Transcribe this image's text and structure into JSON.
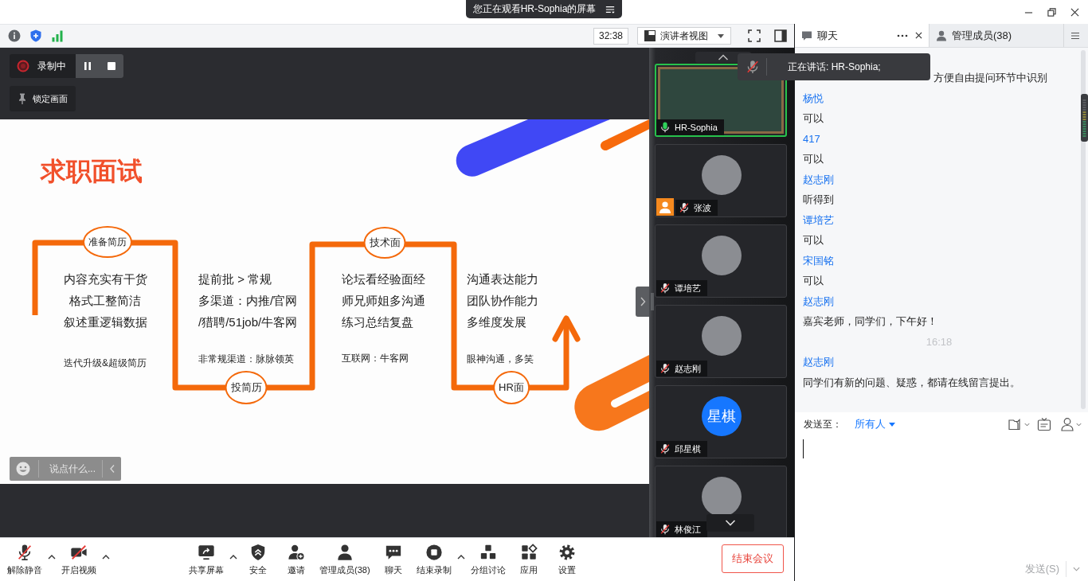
{
  "title_bar": {
    "banner": "您正在观看HR-Sophia的屏幕"
  },
  "top_toolbar": {
    "timer": "32:38",
    "view_button": "演讲者视图"
  },
  "recording": {
    "label": "录制中"
  },
  "lock_button": {
    "label": "锁定画面"
  },
  "slide": {
    "title": "求职面试",
    "stages": [
      {
        "label": "准备简历",
        "lines": [
          "内容充实有干货",
          "格式工整简洁",
          "叙述重逻辑数据"
        ],
        "note": "迭代升级&超级简历"
      },
      {
        "label": "投简历",
        "lines": [
          "提前批 > 常规",
          "多渠道：内推/官网",
          "/猎聘/51job/牛客网"
        ],
        "note": "非常规渠道：脉脉领英"
      },
      {
        "label": "技术面",
        "lines": [
          "论坛看经验面经",
          "师兄师姐多沟通",
          "练习总结复盘"
        ],
        "note": "互联网：牛客网"
      },
      {
        "label": "HR面",
        "lines": [
          "沟通表达能力",
          "团队协作能力",
          "多维度发展"
        ],
        "note": "眼神沟通，多笑"
      }
    ]
  },
  "comment_box": {
    "placeholder": "说点什么..."
  },
  "speaking_banner": {
    "text": "正在讲话: HR-Sophia;"
  },
  "participants": [
    {
      "name": "HR-Sophia",
      "kind": "video",
      "active_speaker": true,
      "muted": false,
      "co_host": false
    },
    {
      "name": "张波",
      "kind": "photo",
      "active_speaker": false,
      "muted": true,
      "co_host": true
    },
    {
      "name": "谭培艺",
      "kind": "photo",
      "active_speaker": false,
      "muted": true,
      "co_host": false
    },
    {
      "name": "赵志刚",
      "kind": "photo",
      "active_speaker": false,
      "muted": true,
      "co_host": false
    },
    {
      "name": "邱星棋",
      "kind": "initials",
      "initials": "星棋",
      "active_speaker": false,
      "muted": true,
      "co_host": false
    },
    {
      "name": "林俊江",
      "kind": "photo",
      "active_speaker": false,
      "muted": true,
      "co_host": false
    }
  ],
  "chat": {
    "tabs": [
      {
        "label": "聊天",
        "selected": true
      },
      {
        "label": "管理成员(38)",
        "selected": false
      }
    ],
    "messages": [
      {
        "kind": "text",
        "text": "方便自由提问环节中识别"
      },
      {
        "kind": "sender",
        "text": "杨悦"
      },
      {
        "kind": "text",
        "text": "可以"
      },
      {
        "kind": "sender",
        "text": "417"
      },
      {
        "kind": "text",
        "text": "可以"
      },
      {
        "kind": "sender",
        "text": "赵志刚"
      },
      {
        "kind": "text",
        "text": "听得到"
      },
      {
        "kind": "sender",
        "text": "谭培艺"
      },
      {
        "kind": "text",
        "text": "可以"
      },
      {
        "kind": "sender",
        "text": "宋国铭"
      },
      {
        "kind": "text",
        "text": "可以"
      },
      {
        "kind": "sender",
        "text": "赵志刚"
      },
      {
        "kind": "text",
        "text": "嘉宾老师，同学们，下午好！"
      },
      {
        "kind": "time",
        "text": "16:18"
      },
      {
        "kind": "sender",
        "text": "赵志刚"
      },
      {
        "kind": "text",
        "text": "同学们有新的问题、疑惑，都请在线留言提出。"
      }
    ],
    "send_to_label": "发送至：",
    "recipient": "所有人",
    "send_button": {
      "label": "发送(S)",
      "disabled": true
    }
  },
  "bottom_toolbar": {
    "left": [
      {
        "kind": "mic-off",
        "label": "解除静音",
        "menu": true
      },
      {
        "kind": "video-off",
        "label": "开启视频",
        "menu": true
      }
    ],
    "center": [
      {
        "kind": "share",
        "label": "共享屏幕",
        "menu": true
      },
      {
        "kind": "security",
        "label": "安全",
        "menu": false
      },
      {
        "kind": "invite",
        "label": "邀请",
        "menu": false
      },
      {
        "kind": "participants",
        "label": "管理成员(38)",
        "menu": false
      },
      {
        "kind": "chat",
        "label": "聊天",
        "menu": false
      },
      {
        "kind": "record-stop",
        "label": "结束录制",
        "menu": true
      },
      {
        "kind": "breakout",
        "label": "分组讨论",
        "menu": false
      },
      {
        "kind": "apps",
        "label": "应用",
        "menu": false
      },
      {
        "kind": "settings",
        "label": "设置",
        "menu": false
      }
    ],
    "end_button": "结束会议"
  }
}
